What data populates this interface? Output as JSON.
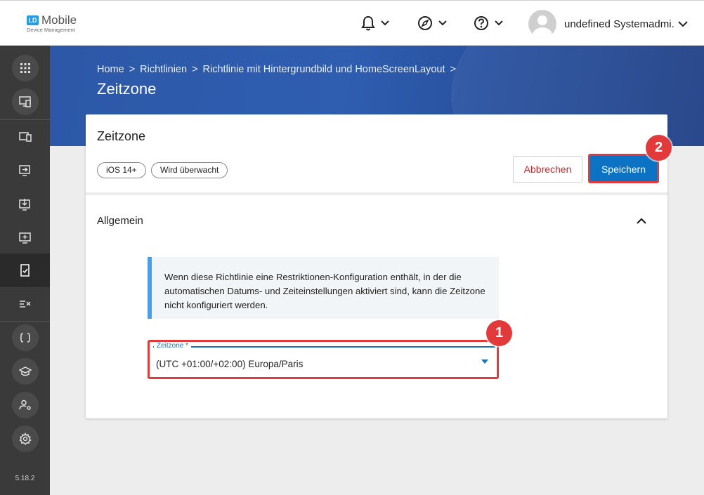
{
  "app": {
    "logo_badge": "LD",
    "logo_main": "Mobile",
    "logo_sub": "Device Management",
    "user_name": "undefined Systemadmi...",
    "version": "5.18.2"
  },
  "topbar_icons": [
    "bell-icon",
    "compass-icon",
    "help-icon"
  ],
  "sidebar": {
    "items": [
      {
        "name": "apps-grid-icon",
        "active": false
      },
      {
        "name": "device-monitor-icon",
        "active": false
      },
      {
        "name": "devices-icon",
        "active": false
      },
      {
        "name": "device-forward-icon",
        "active": false
      },
      {
        "name": "device-download-icon",
        "active": false
      },
      {
        "name": "device-add-icon",
        "active": false
      },
      {
        "name": "policy-check-icon",
        "active": true
      },
      {
        "name": "checklist-icon",
        "active": false
      },
      {
        "name": "braces-icon",
        "active": false
      },
      {
        "name": "education-icon",
        "active": false
      },
      {
        "name": "user-settings-icon",
        "active": false
      },
      {
        "name": "gear-icon",
        "active": false
      }
    ]
  },
  "breadcrumb": {
    "items": [
      "Home",
      "Richtlinien",
      "Richtlinie mit Hintergrundbild und HomeScreenLayout"
    ],
    "separator": ">"
  },
  "page": {
    "title": "Zeitzone"
  },
  "card": {
    "title": "Zeitzone",
    "chips": [
      "iOS 14+",
      "Wird überwacht"
    ],
    "cancel_label": "Abbrechen",
    "save_label": "Speichern",
    "section_title": "Allgemein",
    "info_text": "Wenn diese Richtlinie eine Restriktionen-Konfiguration enthält, in der die automatischen Datums- und Zeiteinstellungen aktiviert sind, kann die Zeitzone nicht konfiguriert werden.",
    "field": {
      "label": "Zeitzone *",
      "value": "(UTC +01:00/+02:00) Europa/Paris"
    }
  },
  "markers": [
    "1",
    "2"
  ],
  "colors": {
    "accent": "#0c72c4",
    "cancel": "#c62828",
    "highlight": "#e23a3a",
    "sidebar": "#3a3a3a",
    "hero": "#2d58a8"
  }
}
